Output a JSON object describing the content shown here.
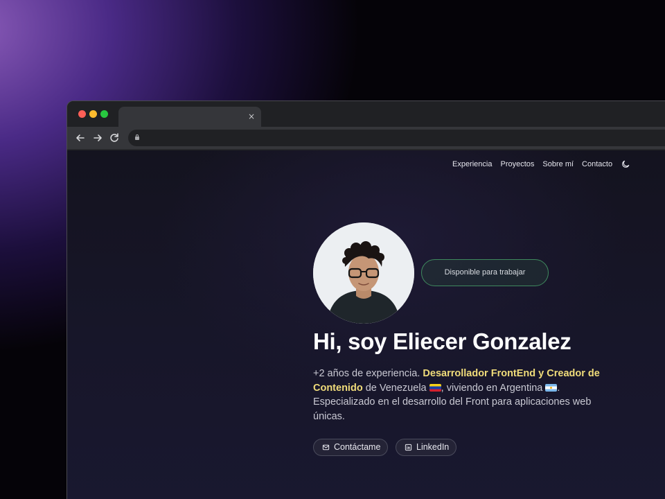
{
  "browser": {
    "traffic_lights": [
      "#ff5f57",
      "#febc2e",
      "#28c840"
    ],
    "tab": {
      "close_glyph": "×",
      "icon": "close-icon"
    },
    "toolbar_icons": [
      "back-arrow-icon",
      "forward-arrow-icon",
      "reload-icon",
      "lock-icon"
    ]
  },
  "site": {
    "nav": {
      "items": [
        "Experiencia",
        "Proyectos",
        "Sobre mí",
        "Contacto"
      ],
      "theme_icon": "moon-icon"
    },
    "hero": {
      "badge": "Disponible para trabajar",
      "title": "Hi, soy Eliecer Gonzalez",
      "description": {
        "part1": "+2 años de experiencia. ",
        "highlight": "Desarrollador FrontEnd y Creador de Contenido",
        "part2": " de Venezuela ",
        "part3": ", viviendo en Argentina ",
        "part4": ". Especializado en el desarrollo del Front para aplicaciones web únicas."
      },
      "buttons": {
        "contact": "Contáctame",
        "linkedin": "LinkedIn"
      }
    },
    "colors": {
      "highlight": "#f0dc7a",
      "badge_border": "#3f8a5e",
      "background": "#171629"
    }
  }
}
